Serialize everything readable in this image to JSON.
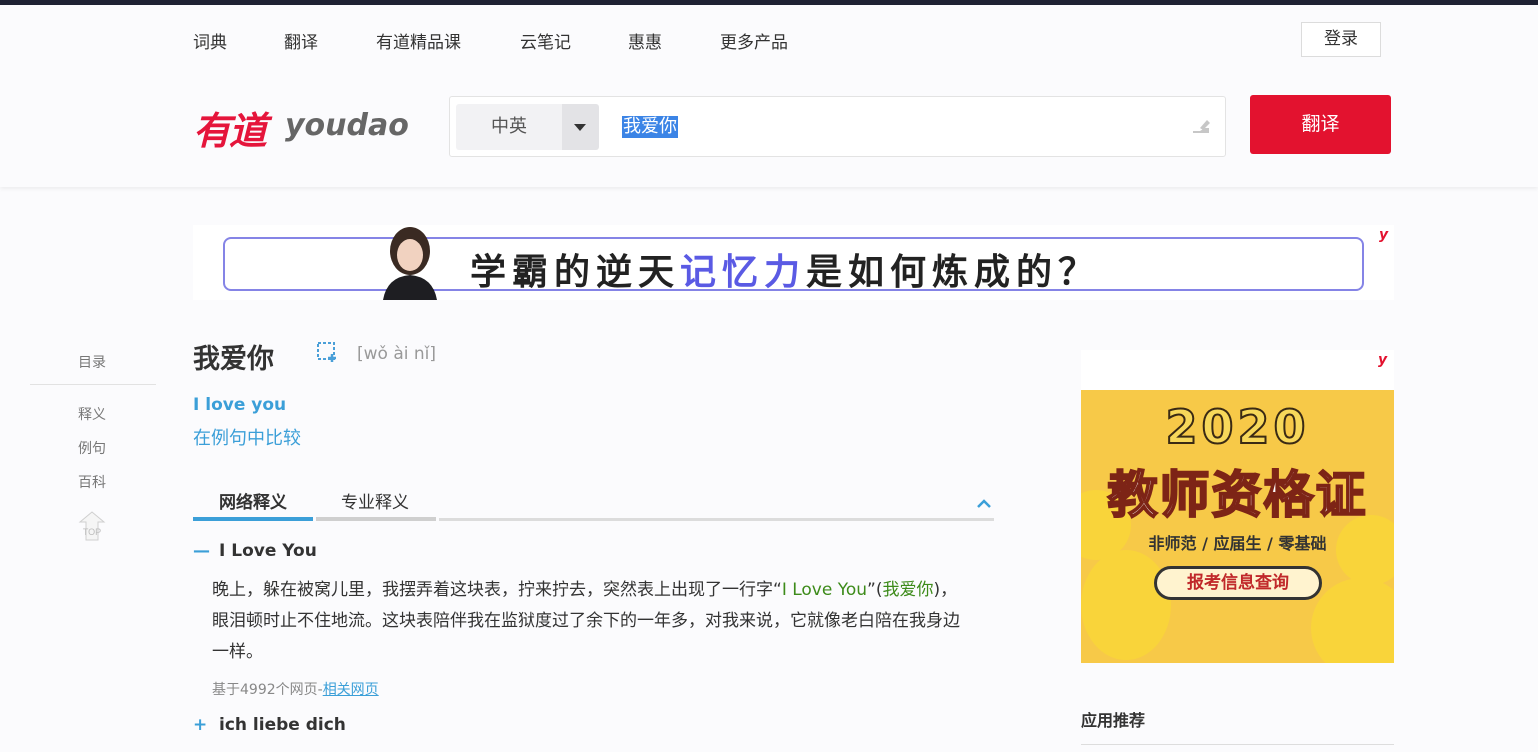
{
  "nav": {
    "items": [
      "词典",
      "翻译",
      "有道精品课",
      "云笔记",
      "惠惠",
      "更多产品"
    ],
    "login": "登录"
  },
  "logo": {
    "cn": "有道",
    "en": "youdao"
  },
  "search": {
    "lang": "中英",
    "query": "我爱你",
    "button": "翻译"
  },
  "banner": {
    "text_a": "学霸的逆天",
    "text_hl": "记忆力",
    "text_b": "是如何炼成的？",
    "ad_mark": "y"
  },
  "toc": {
    "title": "目录",
    "items": [
      "释义",
      "例句",
      "百科"
    ],
    "top": "TOP"
  },
  "entry": {
    "word": "我爱你",
    "phonetic": "[wǒ ài nǐ]",
    "translation": "I love you",
    "compare_link": "在例句中比较"
  },
  "tabs": [
    "网络释义",
    "专业释义"
  ],
  "web_def": {
    "term": "I Love You",
    "sign_open": "—",
    "body_a": "晚上，躲在被窝儿里，我摆弄着这块表，拧来拧去，突然表上出现了一行字“",
    "body_hl1": "I Love You",
    "body_mid": "”(",
    "body_hl2": "我爱你",
    "body_b": ")，眼泪顿时止不住地流。这块表陪伴我在监狱度过了余下的一年多，对我来说，它就像老白陪在我身边一样。",
    "source_prefix": "基于4992个网页-",
    "source_link": "相关网页",
    "term2": "ich liebe dich",
    "sign_closed": "+"
  },
  "side_ad": {
    "year": "2020",
    "title": "教师资格证",
    "sub": "非师范 / 应届生 / 零基础",
    "btn": "报考信息查询",
    "ad_mark": "y"
  },
  "apps": {
    "title": "应用推荐"
  },
  "colors": {
    "brand_red": "#e3122f",
    "link_blue": "#3b9fd8",
    "highlight_green": "#3d8b1a"
  }
}
